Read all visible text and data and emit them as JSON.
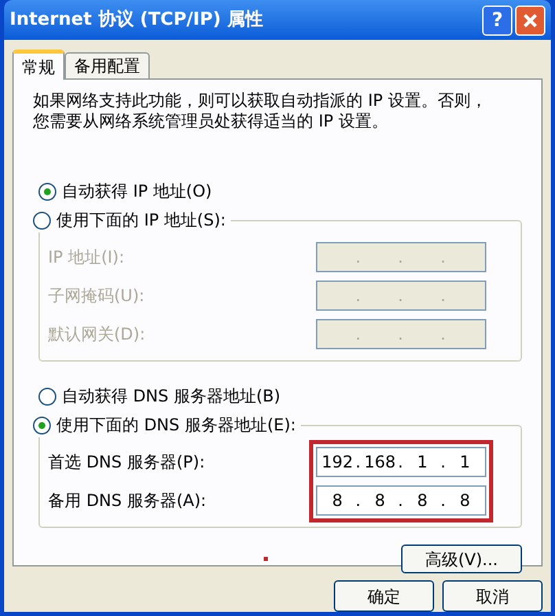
{
  "window": {
    "title": "Internet 协议 (TCP/IP) 属性",
    "help": "?"
  },
  "tabs": [
    {
      "label": "常规",
      "selected": true
    },
    {
      "label": "备用配置",
      "selected": false
    }
  ],
  "description": [
    "如果网络支持此功能，则可以获取自动指派的 IP 设置。否则，",
    "您需要从网络系统管理员处获得适当的 IP 设置。"
  ],
  "separator": ".",
  "ip_mode": [
    {
      "label": "自动获得 IP 地址(O)",
      "selected": true
    },
    {
      "label": "使用下面的 IP 地址(S):",
      "selected": false
    }
  ],
  "ip_group": {
    "disabled": true,
    "fields": [
      {
        "label": "IP 地址(I):"
      },
      {
        "label": "子网掩码(U):"
      },
      {
        "label": "默认网关(D):"
      }
    ]
  },
  "dns_mode": [
    {
      "label": "自动获得 DNS 服务器地址(B)",
      "selected": false
    },
    {
      "label": "使用下面的 DNS 服务器地址(E):",
      "selected": true
    }
  ],
  "dns_group": {
    "disabled": false,
    "highlighted": true,
    "fields": [
      {
        "label": "首选 DNS 服务器(P):",
        "octets": [
          "192",
          "168",
          "1",
          "1"
        ]
      },
      {
        "label": "备用 DNS 服务器(A):",
        "octets": [
          "8",
          "8",
          "8",
          "8"
        ]
      }
    ]
  },
  "advanced_button": "高级(V)...",
  "buttons": [
    "确定",
    "取消"
  ]
}
